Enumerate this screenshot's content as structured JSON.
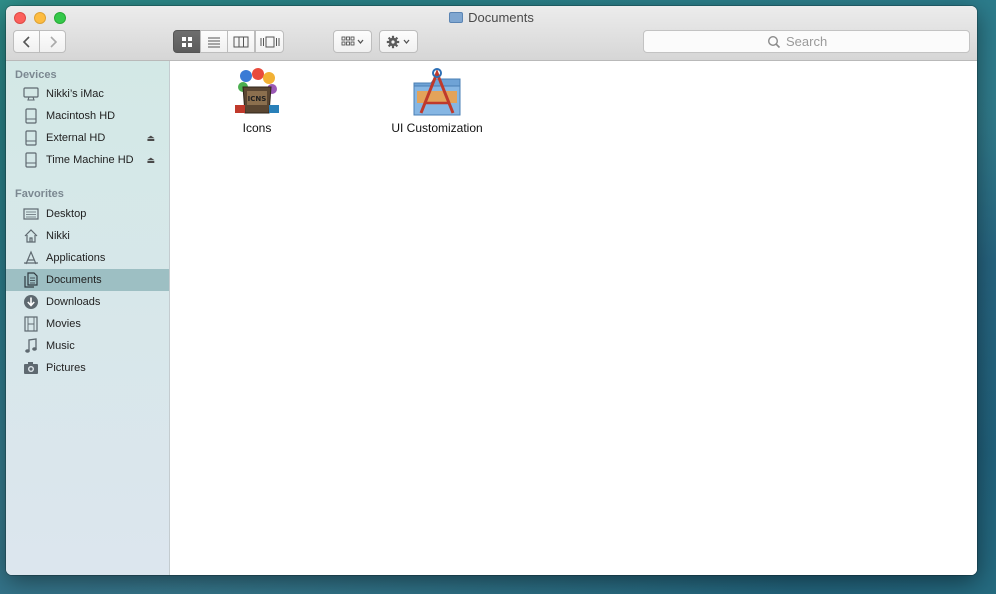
{
  "window": {
    "title": "Documents"
  },
  "toolbar": {
    "search_placeholder": "Search"
  },
  "sidebar": {
    "devices_title": "Devices",
    "devices": [
      {
        "label": "Nikki’s iMac",
        "icon": "imac-icon"
      },
      {
        "label": "Macintosh HD",
        "icon": "hard-drive-icon"
      },
      {
        "label": "External HD",
        "icon": "hard-drive-icon",
        "eject": "⏏"
      },
      {
        "label": "Time Machine HD",
        "icon": "hard-drive-icon",
        "eject": "⏏"
      }
    ],
    "favorites_title": "Favorites",
    "favorites": [
      {
        "label": "Desktop",
        "icon": "desktop-icon"
      },
      {
        "label": "Nikki",
        "icon": "home-icon"
      },
      {
        "label": "Applications",
        "icon": "applications-icon"
      },
      {
        "label": "Documents",
        "icon": "documents-icon",
        "selected": true
      },
      {
        "label": "Downloads",
        "icon": "downloads-icon"
      },
      {
        "label": "Movies",
        "icon": "movies-icon"
      },
      {
        "label": "Music",
        "icon": "music-icon"
      },
      {
        "label": "Pictures",
        "icon": "pictures-icon"
      }
    ]
  },
  "files": [
    {
      "name": "Icons",
      "icon": "icons-box-icon"
    },
    {
      "name": "UI Customization",
      "icon": "xcode-folder-icon"
    }
  ],
  "colors": {
    "selection": "#9dbfc3",
    "sidebar": "#d3e8e6"
  }
}
